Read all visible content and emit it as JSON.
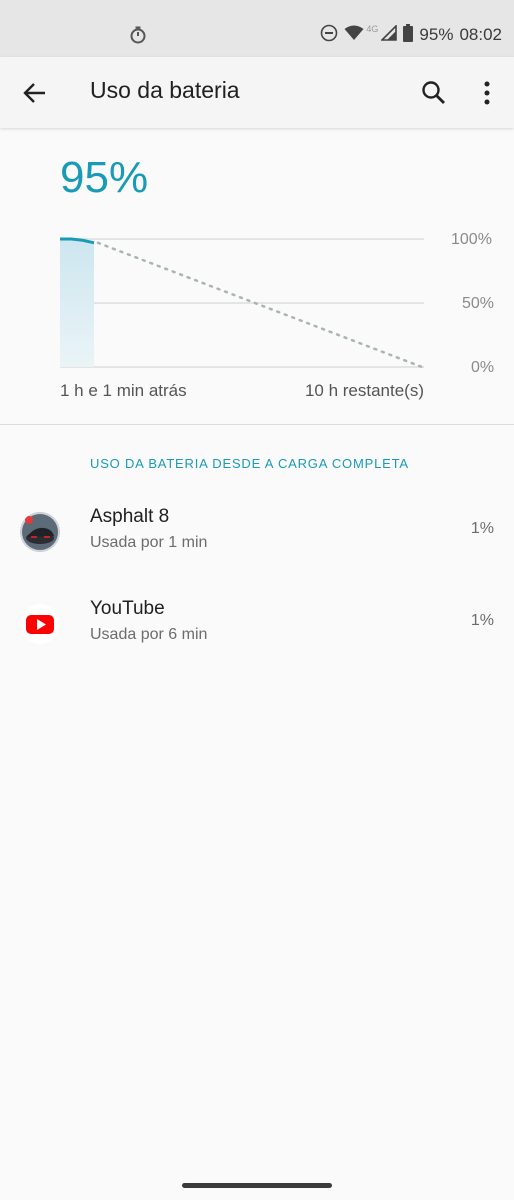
{
  "status_bar": {
    "battery_percent": "95%",
    "time": "08:02",
    "network": "4G",
    "icons": [
      "timer-icon",
      "do-not-disturb-icon",
      "wifi-icon",
      "cellular-signal-icon",
      "battery-icon"
    ]
  },
  "app_bar": {
    "title": "Uso da bateria",
    "icons": [
      "back-arrow-icon",
      "search-icon",
      "more-vert-icon"
    ]
  },
  "summary": {
    "current_level": "95%",
    "axis_labels": [
      "100%",
      "50%",
      "0%"
    ],
    "time_left_label": "1 h e 1 min atrás",
    "time_right_label": "10 h restante(s)"
  },
  "chart_data": {
    "type": "area",
    "y_axis_ticks": [
      "100%",
      "50%",
      "0%"
    ],
    "ylim": [
      0,
      100
    ],
    "history": {
      "x_start_label": "1 h e 1 min atrás",
      "values": [
        100,
        100,
        99,
        97
      ],
      "unit": "%"
    },
    "projection": {
      "from": 97,
      "to": 0,
      "end_label": "10 h restante(s)"
    },
    "grid": true
  },
  "section": {
    "header": "USO DA BATERIA DESDE A CARGA COMPLETA"
  },
  "apps": [
    {
      "name": "Asphalt 8",
      "usage": "Usada por 1 min",
      "percent": "1%",
      "icon": "asphalt-8-icon"
    },
    {
      "name": "YouTube",
      "usage": "Usada por 6 min",
      "percent": "1%",
      "icon": "youtube-icon"
    }
  ],
  "colors": {
    "accent": "#1a9bb5",
    "chart_fill": "#d6ebf2",
    "background": "#fafafa"
  }
}
